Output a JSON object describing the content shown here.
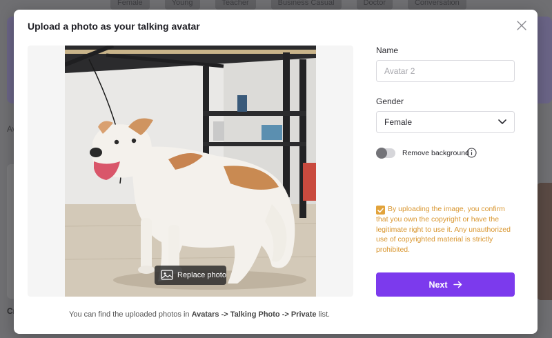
{
  "background": {
    "chips": [
      "Female",
      "Young",
      "Teacher",
      "Business Casual",
      "Doctor",
      "Conversation"
    ],
    "left_text_1": "Av",
    "left_text_2": "Cr"
  },
  "modal": {
    "title": "Upload a photo as your talking avatar",
    "close_icon": "close-icon",
    "photo": {
      "alt": "Uploaded dog photo",
      "replace_label": "Replace photo",
      "replace_icon": "image-replace-icon"
    },
    "footer": {
      "prefix": "You can find the uploaded photos in ",
      "path_1": "Avatars",
      "sep_1": " -> ",
      "path_2": "Talking Photo",
      "sep_2": " -> ",
      "path_3": "Private",
      "suffix": " list."
    },
    "form": {
      "name_label": "Name",
      "name_placeholder": "Avatar 2",
      "name_value": "",
      "gender_label": "Gender",
      "gender_value": "Female",
      "remove_bg_label": "Remove background",
      "remove_bg_enabled": false,
      "consent_checked": true,
      "consent_text": "By uploading the image, you confirm that you own the copyright or have the legitimate right to use it. Any unauthorized use of copyrighted material is strictly prohibited.",
      "next_label": "Next"
    }
  },
  "colors": {
    "accent": "#7c3aed",
    "warning": "#d9962f",
    "checkbox": "#e2a33b"
  }
}
